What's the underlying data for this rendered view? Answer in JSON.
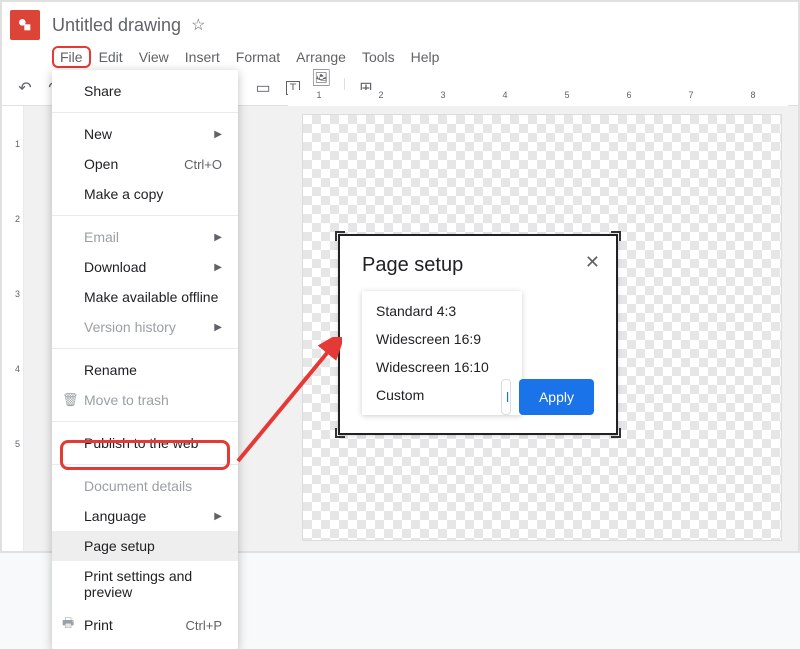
{
  "title": "Untitled drawing",
  "menubar": [
    "File",
    "Edit",
    "View",
    "Insert",
    "Format",
    "Arrange",
    "Tools",
    "Help"
  ],
  "file_menu": {
    "share": "Share",
    "new": "New",
    "open": "Open",
    "open_shortcut": "Ctrl+O",
    "make_copy": "Make a copy",
    "email": "Email",
    "download": "Download",
    "offline": "Make available offline",
    "version_history": "Version history",
    "rename": "Rename",
    "move_trash": "Move to trash",
    "publish": "Publish to the web",
    "doc_details": "Document details",
    "language": "Language",
    "page_setup": "Page setup",
    "print_preview": "Print settings and preview",
    "print": "Print",
    "print_shortcut": "Ctrl+P"
  },
  "page_setup_dialog": {
    "title": "Page setup",
    "options": [
      "Standard 4:3",
      "Widescreen 16:9",
      "Widescreen 16:10",
      "Custom"
    ],
    "apply": "Apply"
  },
  "hruler_start": 1,
  "hruler_end": 8,
  "vruler_start": 1,
  "vruler_end": 5,
  "colors": {
    "accent": "#1a73e8",
    "highlight": "#e53935"
  }
}
